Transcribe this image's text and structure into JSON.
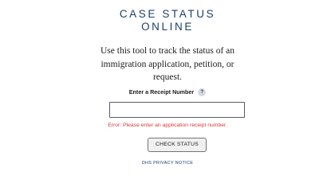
{
  "header": {
    "title_line1": "CASE STATUS",
    "title_line2": "ONLINE"
  },
  "description": {
    "line1": "Use this tool to track the status of an",
    "line2": "immigration application, petition, or",
    "line3": "request."
  },
  "receipt_field": {
    "label": "Enter a Receipt Number",
    "help_icon": "?",
    "value": "",
    "placeholder": ""
  },
  "error": {
    "message": "Error: Please enter an application receipt number."
  },
  "actions": {
    "check_status_label": "CHECK STATUS"
  },
  "footer": {
    "privacy_link": "DHS PRIVACY NOTICE"
  },
  "colors": {
    "title": "#1b3f6e",
    "error": "#d83933",
    "link": "#1b3f6e"
  }
}
